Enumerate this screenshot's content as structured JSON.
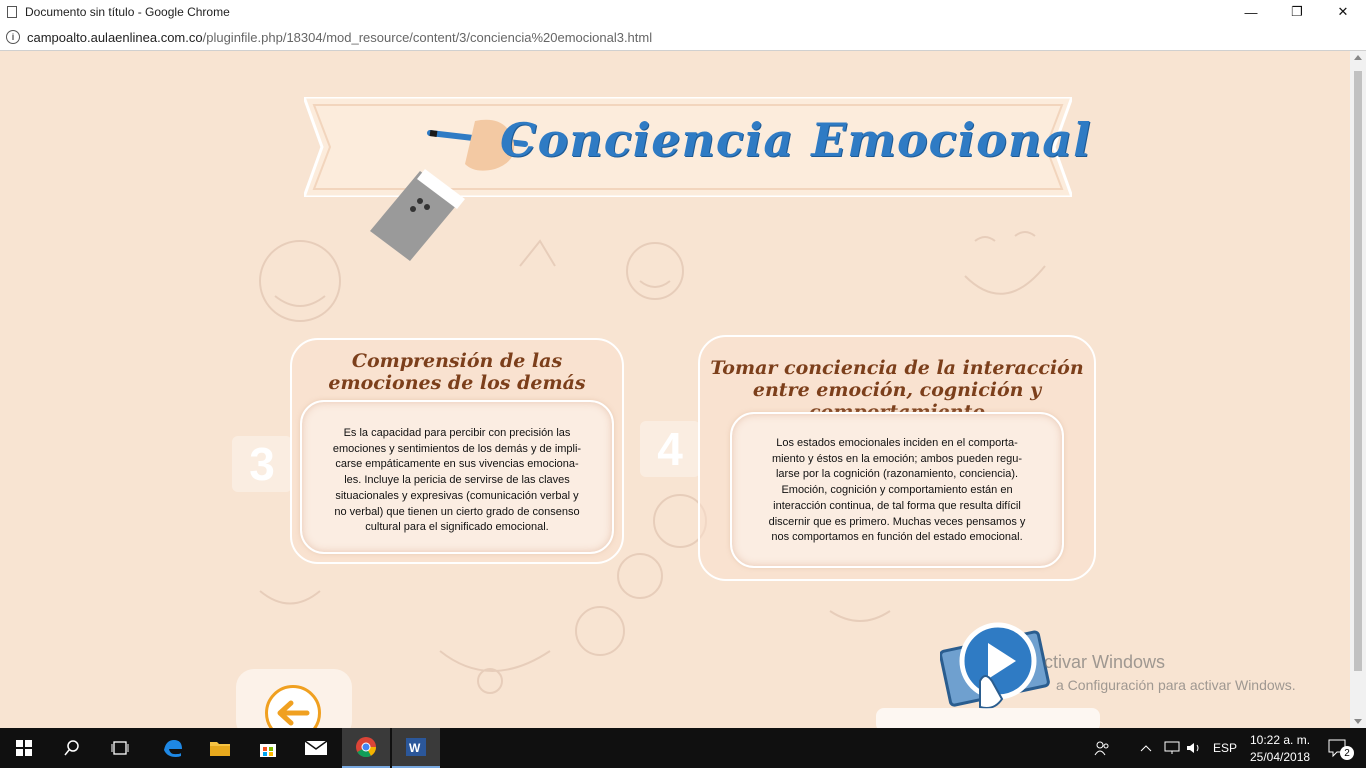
{
  "window": {
    "title": "Documento sin título - Google Chrome",
    "controls": [
      "—",
      "❐",
      "✕"
    ]
  },
  "address": {
    "host": "campoalto.aulaenlinea.com.co",
    "path": "/pluginfile.php/18304/mod_resource/content/3/conciencia%20emocional3.html"
  },
  "banner": {
    "title": "Conciencia Emocional"
  },
  "cards": [
    {
      "number": "3",
      "title_line1": "Comprensión de las",
      "title_line2": "emociones de los demás",
      "body_lines": [
        "Es la capacidad para percibir con precisión las",
        "emociones y sentimientos de los demás y de impli-",
        "carse empáticamente en sus vivencias emociona-",
        "les. Incluye la pericia de servirse de las claves",
        "situacionales y expresivas (comunicación verbal y",
        "no verbal) que tienen un cierto grado de consenso",
        "cultural para el significado emocional."
      ]
    },
    {
      "number": "4",
      "title_line1": "Tomar conciencia de la interacción",
      "title_line2": "entre emoción, cognición y comportamiento",
      "body_lines": [
        "Los estados emocionales inciden en el comporta-",
        "miento y éstos en la emoción; ambos pueden regu-",
        "larse por la cognición (razonamiento, conciencia).",
        "Emoción, cognición y comportamiento están en",
        "interacción continua, de tal forma que resulta difícil",
        "discernir que es primero. Muchas veces pensamos y",
        "nos comportamos en función del estado emocional."
      ]
    }
  ],
  "watermark": {
    "line1": "ctivar Windows",
    "line2": "a Configuración para activar Windows."
  },
  "taskbar": {
    "lang": "ESP",
    "time": "10:22 a. m.",
    "date": "25/04/2018",
    "notifications": "2"
  },
  "colors": {
    "page_bg": "#f8e4d2",
    "title_blue": "#2f7bc4",
    "card_title_brown": "#7c3f1b",
    "back_orange": "#f0a020"
  }
}
